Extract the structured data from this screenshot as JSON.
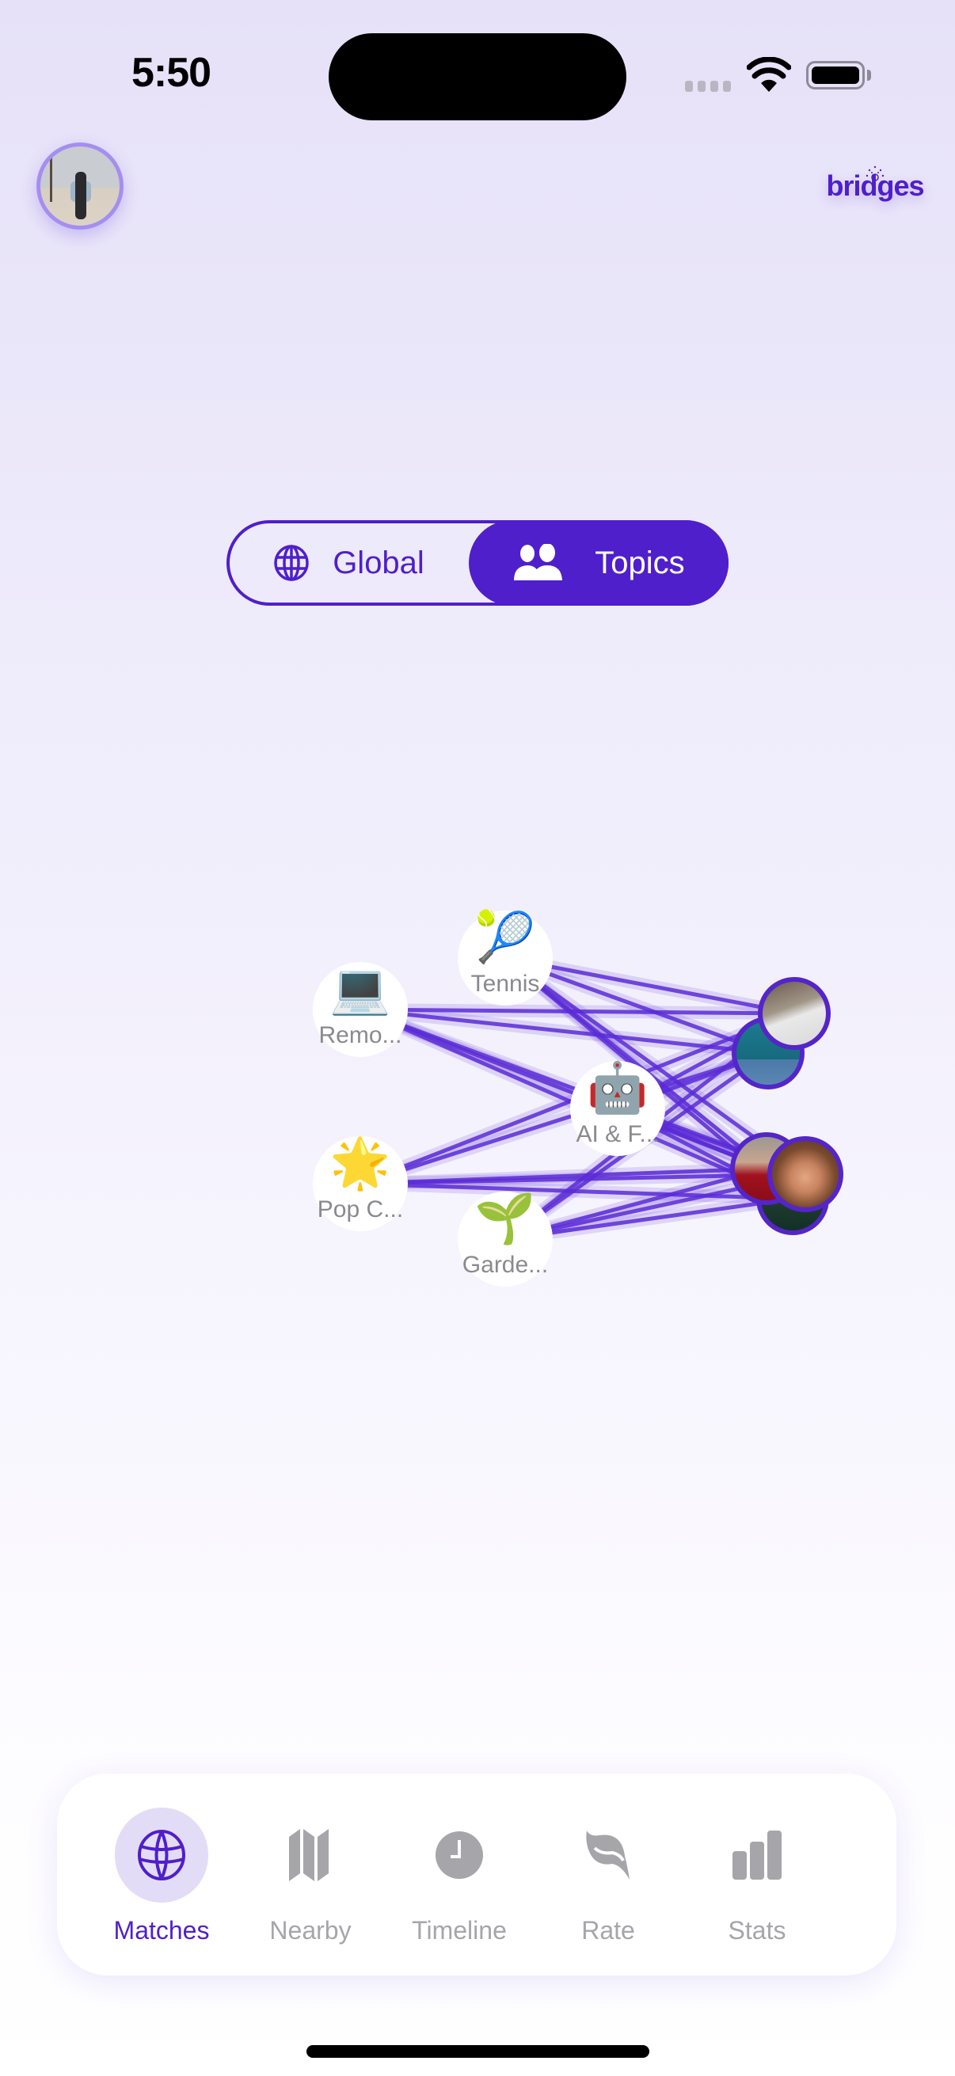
{
  "status_bar": {
    "time": "5:50",
    "wifi_icon": "wifi-icon",
    "battery_icon": "battery-full-icon"
  },
  "header": {
    "profile_avatar": "profile-photo",
    "logo_text": "bridges"
  },
  "view_toggle": {
    "options": [
      {
        "label": "Global",
        "icon": "globe-icon",
        "selected": false
      },
      {
        "label": "Topics",
        "icon": "people-icon",
        "selected": true
      }
    ]
  },
  "graph": {
    "topics": [
      {
        "label": "Remo...",
        "emoji": "💻",
        "icon": "laptop-icon"
      },
      {
        "label": "Tennis",
        "emoji": "🎾",
        "icon": "tennis-ball-icon"
      },
      {
        "label": "AI & F...",
        "emoji": "🤖",
        "icon": "robot-icon"
      },
      {
        "label": "Pop C...",
        "emoji": "🌟",
        "icon": "glowing-star-icon"
      },
      {
        "label": "Garde...",
        "emoji": "🌱",
        "icon": "seedling-icon"
      }
    ],
    "matches": [
      {
        "name": "match-1"
      },
      {
        "name": "match-2"
      },
      {
        "name": "match-3"
      },
      {
        "name": "match-4"
      },
      {
        "name": "match-5"
      }
    ],
    "edge_color": "#5a2bd6"
  },
  "tab_bar": {
    "tabs": [
      {
        "label": "Matches",
        "icon": "globe-icon",
        "active": true
      },
      {
        "label": "Nearby",
        "icon": "map-icon",
        "active": false
      },
      {
        "label": "Timeline",
        "icon": "clock-icon",
        "active": false
      },
      {
        "label": "Rate",
        "icon": "leaf-icon",
        "active": false
      },
      {
        "label": "Stats",
        "icon": "bar-chart-icon",
        "active": false
      }
    ]
  },
  "colors": {
    "accent": "#4f1fcb",
    "inactive": "#a5a5aa",
    "active_tab_bg": "#e3dcf6"
  }
}
